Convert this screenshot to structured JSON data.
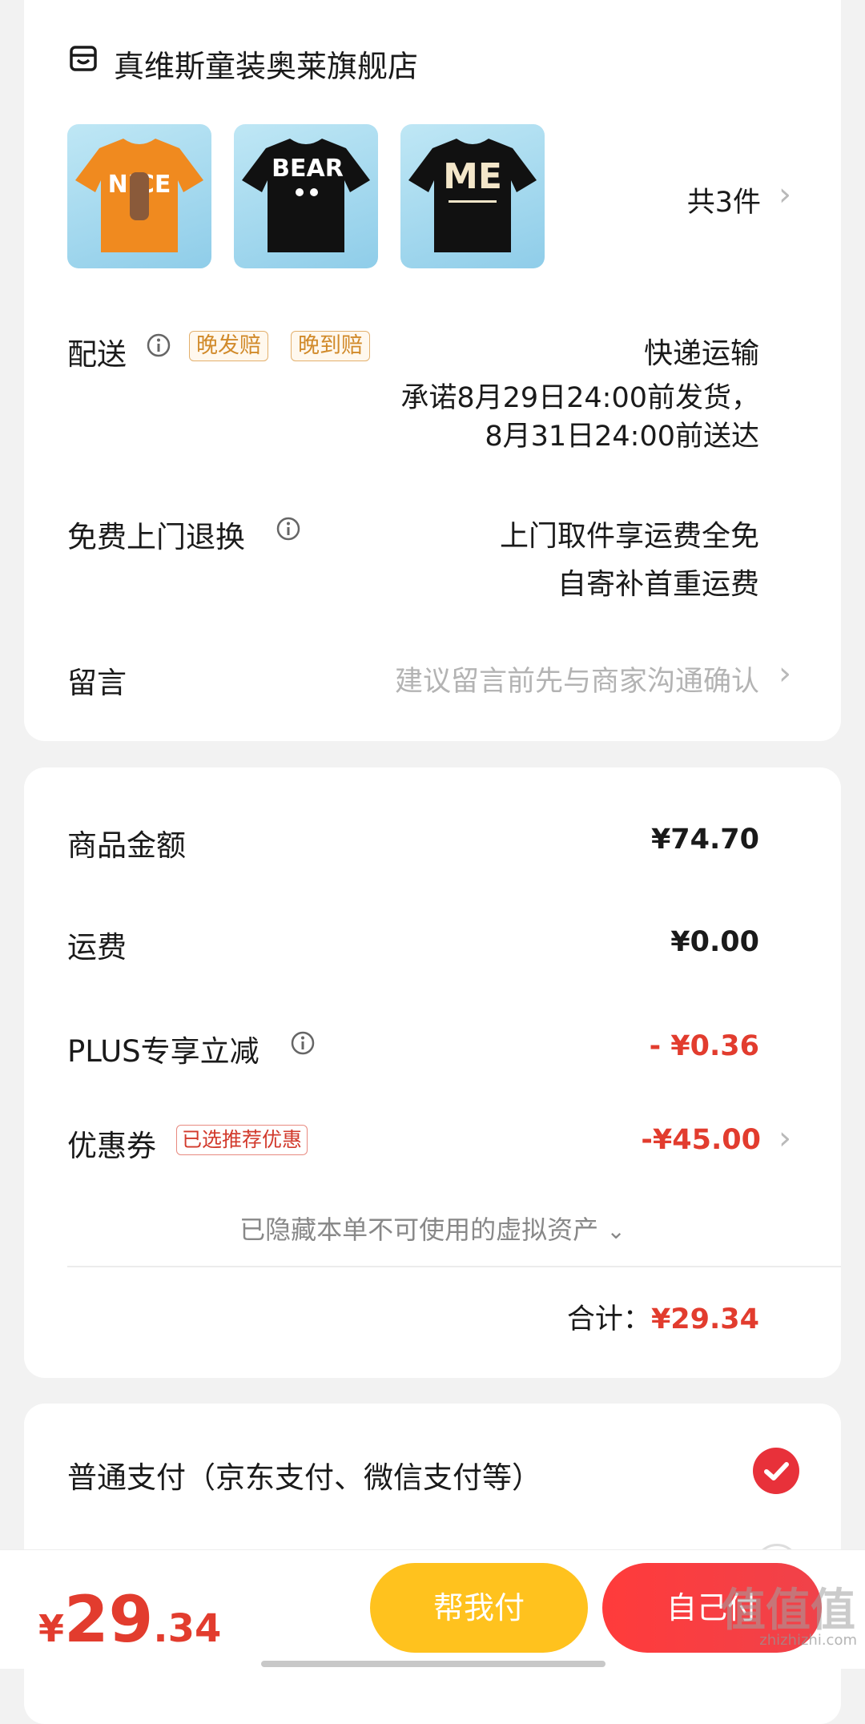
{
  "shop": {
    "name": "真维斯童装奥莱旗舰店",
    "products": [
      {
        "name": "orange-tshirt",
        "print": "NICE",
        "color": "#f08a1f",
        "textcolor": "#ffffff"
      },
      {
        "name": "black-tshirt-bear",
        "print": "BEAR",
        "color": "#111111",
        "textcolor": "#ffffff"
      },
      {
        "name": "black-tshirt-me",
        "print": "ME",
        "color": "#111111",
        "textcolor": "#f3e6c9"
      }
    ],
    "count_label": "共3件"
  },
  "delivery": {
    "label": "配送",
    "tags": [
      "晚发赔",
      "晚到赔"
    ],
    "method": "快递运输",
    "promise_line1": "承诺8月29日24:00前发货，",
    "promise_line2": "8月31日24:00前送达"
  },
  "return": {
    "label": "免费上门退换",
    "line1": "上门取件享运费全免",
    "line2": "自寄补首重运费"
  },
  "message": {
    "label": "留言",
    "placeholder": "建议留言前先与商家沟通确认"
  },
  "prices": {
    "goods_label": "商品金额",
    "goods_value": "¥74.70",
    "shipping_label": "运费",
    "shipping_value": "¥0.00",
    "plus_label": "PLUS专享立减",
    "plus_value": "- ¥0.36",
    "coupon_label": "优惠券",
    "coupon_tag": "已选推荐优惠",
    "coupon_value": "-¥45.00",
    "hidden_assets": "已隐藏本单不可使用的虚拟资产",
    "total_label": "合计：",
    "total_value": "¥29.34"
  },
  "payment": {
    "normal_label": "普通支付（京东支付、微信支付等）"
  },
  "bottom_bar": {
    "currency": "¥",
    "price_int": "29",
    "price_dec": ".34",
    "help_pay": "帮我付",
    "self_pay": "自己付",
    "watermark": "值值值",
    "watermark_url": "zhizhizhi.com"
  },
  "colors": {
    "accent_red": "#e23c2e",
    "help_pay_yellow": "#ffc21e",
    "self_pay_red": "#f23b3b"
  }
}
